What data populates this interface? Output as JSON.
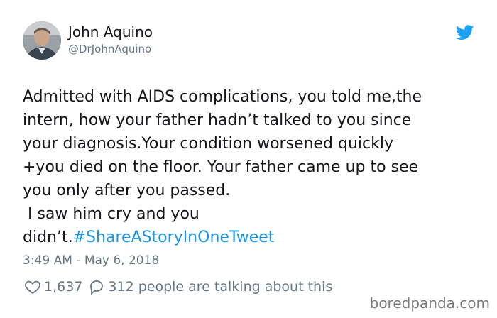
{
  "author": {
    "name": "John Aquino",
    "handle": "@DrJohnAquino"
  },
  "tweet": {
    "lines": [
      "Admitted with AIDS complications, you told me,the",
      "intern, how your father hadn’t talked to you since",
      "your diagnosis.Your condition worsened quickly",
      "+you died on the floor. Your father came up to see",
      "you only after you passed.",
      " I saw him cry and you"
    ],
    "last_line_text": "didn’t.",
    "hashtag": "#ShareAStoryInOneTweet"
  },
  "timestamp": "3:49 AM - May 6, 2018",
  "actions": {
    "like_count": "1,637",
    "reply_text": "312 people are talking about this"
  },
  "watermark": "boredpanda.com",
  "colors": {
    "accent": "#1b95e0",
    "muted": "#657786",
    "text": "#14171a"
  },
  "icons": {
    "brand": "twitter-bird-icon",
    "like": "heart-icon",
    "reply": "speech-bubble-icon"
  }
}
